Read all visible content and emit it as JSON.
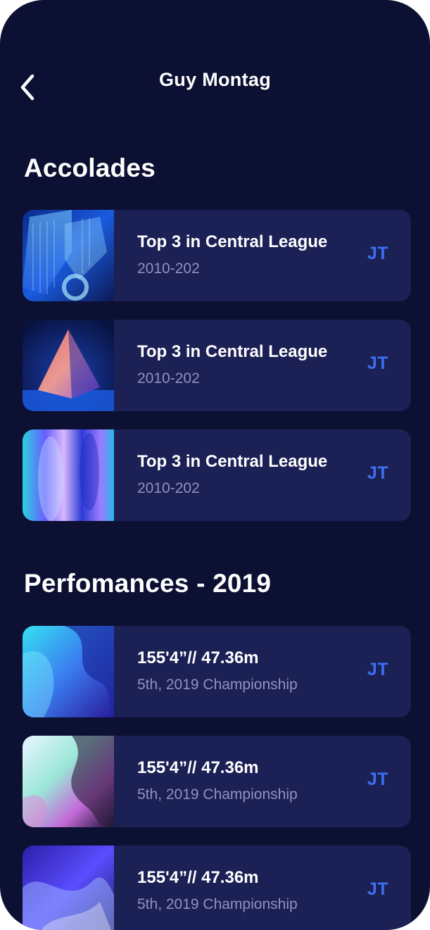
{
  "header": {
    "title": "Guy Montag"
  },
  "sections": [
    {
      "title": "Accolades",
      "items": [
        {
          "title": "Top 3 in Central League",
          "subtitle": "2010-202",
          "badge": "JT"
        },
        {
          "title": "Top 3 in Central League",
          "subtitle": "2010-202",
          "badge": "JT"
        },
        {
          "title": "Top 3 in Central League",
          "subtitle": "2010-202",
          "badge": "JT"
        }
      ]
    },
    {
      "title": "Perfomances - 2019",
      "items": [
        {
          "title": "155'4”// 47.36m",
          "subtitle": "5th, 2019 Championship",
          "badge": "JT"
        },
        {
          "title": "155'4”// 47.36m",
          "subtitle": "5th, 2019 Championship",
          "badge": "JT"
        },
        {
          "title": "155'4”// 47.36m",
          "subtitle": "5th, 2019 Championship",
          "badge": "JT"
        }
      ]
    }
  ],
  "colors": {
    "background": "#0c1032",
    "card": "#1b2055",
    "badge": "#3d6ff2",
    "subtitle": "#8e93c0"
  },
  "icons": {
    "back": "chevron-left-icon"
  }
}
